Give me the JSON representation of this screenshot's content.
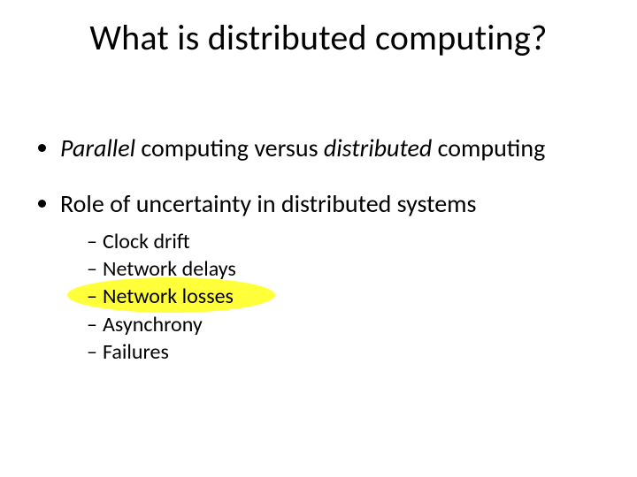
{
  "title": "What is distributed computing?",
  "bullets": {
    "b1_parallel": "Parallel",
    "b1_mid": " computing versus ",
    "b1_distributed": "distributed",
    "b1_tail": " computing",
    "b2": "Role of uncertainty in distributed systems",
    "sub": {
      "s1": "Clock drift",
      "s2": "Network delays",
      "s3": "Network  losses",
      "s4": "Asynchrony",
      "s5": "Failures"
    }
  },
  "dash": "–"
}
